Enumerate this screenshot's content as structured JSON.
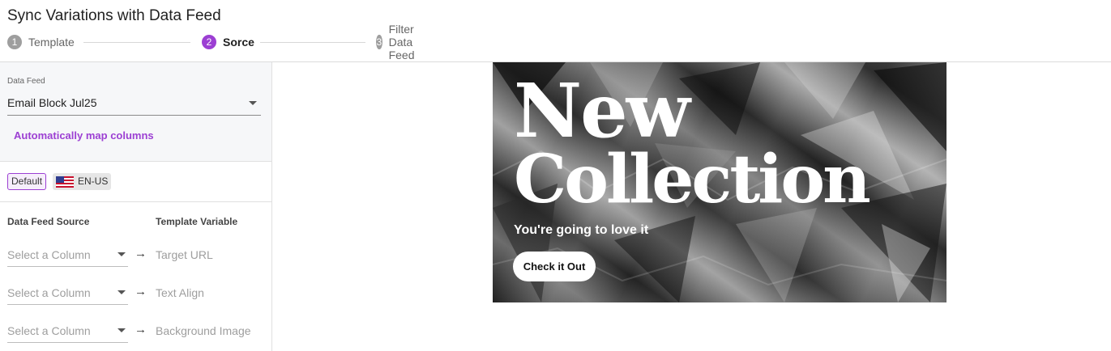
{
  "header": {
    "title": "Sync Variations with Data Feed",
    "steps": [
      {
        "number": "1",
        "label": "Template",
        "state": "done"
      },
      {
        "number": "2",
        "label": "Sorce",
        "state": "active"
      },
      {
        "number": "3",
        "label": "Filter Data Feed",
        "state": "pending"
      }
    ]
  },
  "sidebar": {
    "data_feed_label": "Data Feed",
    "data_feed_value": "Email Block Jul25",
    "auto_map_label": "Automatically map columns",
    "locales": {
      "default_label": "Default",
      "locale_label": "EN-US",
      "locale_icon": "us-flag-icon"
    },
    "mapping": {
      "source_header": "Data Feed Source",
      "variable_header": "Template Variable",
      "rows": [
        {
          "source_placeholder": "Select a Column",
          "target": "Target URL"
        },
        {
          "source_placeholder": "Select a Column",
          "target": "Text Align"
        },
        {
          "source_placeholder": "Select a Column",
          "target": "Background Image"
        }
      ]
    }
  },
  "preview": {
    "headline_line1": "New",
    "headline_line2": "Collection",
    "subline": "You're going to love it",
    "cta_label": "Check it Out"
  },
  "colors": {
    "accent": "#9c3fd3",
    "step_inactive": "#9e9e9e",
    "panel_bg": "#f6f7f9"
  }
}
